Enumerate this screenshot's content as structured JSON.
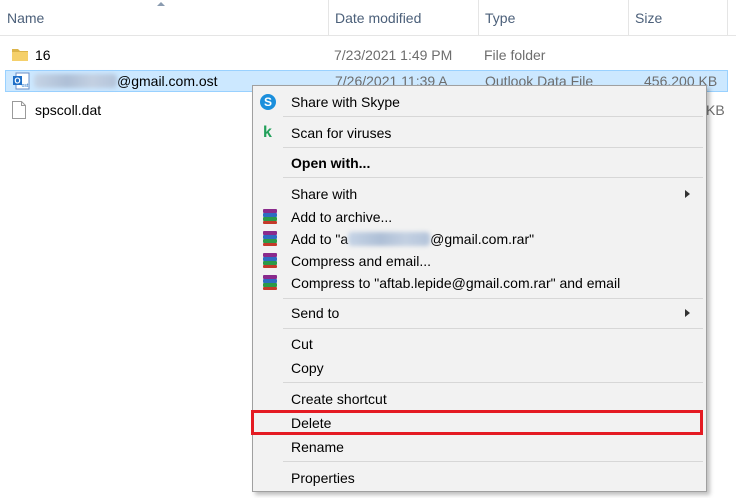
{
  "columns": {
    "name": "Name",
    "date_modified": "Date modified",
    "type": "Type",
    "size": "Size"
  },
  "files": [
    {
      "name": "16",
      "date": "7/23/2021 1:49 PM",
      "type": "File folder",
      "size": "",
      "icon": "folder-icon"
    },
    {
      "name": "@gmail.com.ost",
      "date": "7/26/2021 11:39 A",
      "type": "Outlook Data File",
      "size": "456,200 KB",
      "icon": "outlook-data-file-icon",
      "selected": true
    },
    {
      "name": "spscoll.dat",
      "date": "",
      "type": "",
      "size": "KB",
      "icon": "generic-file-icon"
    }
  ],
  "context_menu": {
    "items": [
      {
        "label": "Share with Skype",
        "icon": "skype-icon"
      },
      {
        "label": "Scan for viruses",
        "icon": "kaspersky-icon"
      },
      {
        "label": "Open with...",
        "bold": true
      },
      {
        "label": "Share with",
        "submenu": true
      },
      {
        "label": "Add to archive...",
        "icon": "winrar-icon"
      },
      {
        "label_prefix": "Add to \"a",
        "label_suffix": "@gmail.com.rar\"",
        "icon": "winrar-icon"
      },
      {
        "label": "Compress and email...",
        "icon": "winrar-icon"
      },
      {
        "label": "Compress to \"aftab.lepide@gmail.com.rar\" and email",
        "icon": "winrar-icon"
      },
      {
        "label": "Send to",
        "submenu": true
      },
      {
        "label": "Cut"
      },
      {
        "label": "Copy"
      },
      {
        "label": "Create shortcut"
      },
      {
        "label": "Delete",
        "highlighted": true
      },
      {
        "label": "Rename"
      },
      {
        "label": "Properties"
      }
    ]
  },
  "colors": {
    "selection": "#cce8ff",
    "highlight_border": "#e41b23",
    "menu_background": "#f2f2f2"
  }
}
